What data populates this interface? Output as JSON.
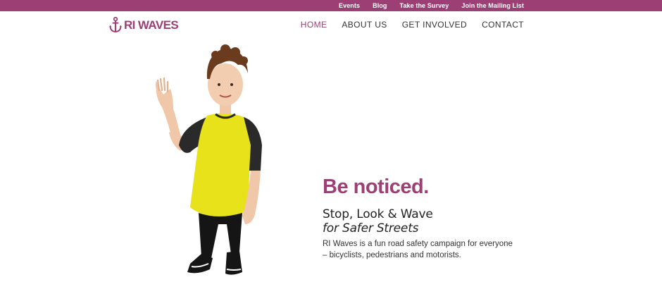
{
  "colors": {
    "brand": "#9c3f74",
    "text": "#222222",
    "background": "#ffffff",
    "shirt": "#e8e21a",
    "sleeves": "#2a2a2a"
  },
  "topbar": {
    "links": [
      "Events",
      "Blog",
      "Take the Survey",
      "Join the Mailing List"
    ]
  },
  "header": {
    "logo_text": "RI WAVES",
    "logo_icon": "anchor-icon",
    "nav": [
      {
        "label": "HOME",
        "active": true
      },
      {
        "label": "ABOUT US",
        "active": false
      },
      {
        "label": "GET INVOLVED",
        "active": false
      },
      {
        "label": "CONTACT",
        "active": false
      }
    ]
  },
  "hero": {
    "image": "boy-waving-yellow-shirt",
    "headline": "Be noticed.",
    "subheadline_line1": "Stop, Look & Wave",
    "subheadline_line2": "for Safer Streets",
    "description": "RI Waves is a fun road safety campaign for everyone – bicyclists, pedestrians and motorists."
  }
}
